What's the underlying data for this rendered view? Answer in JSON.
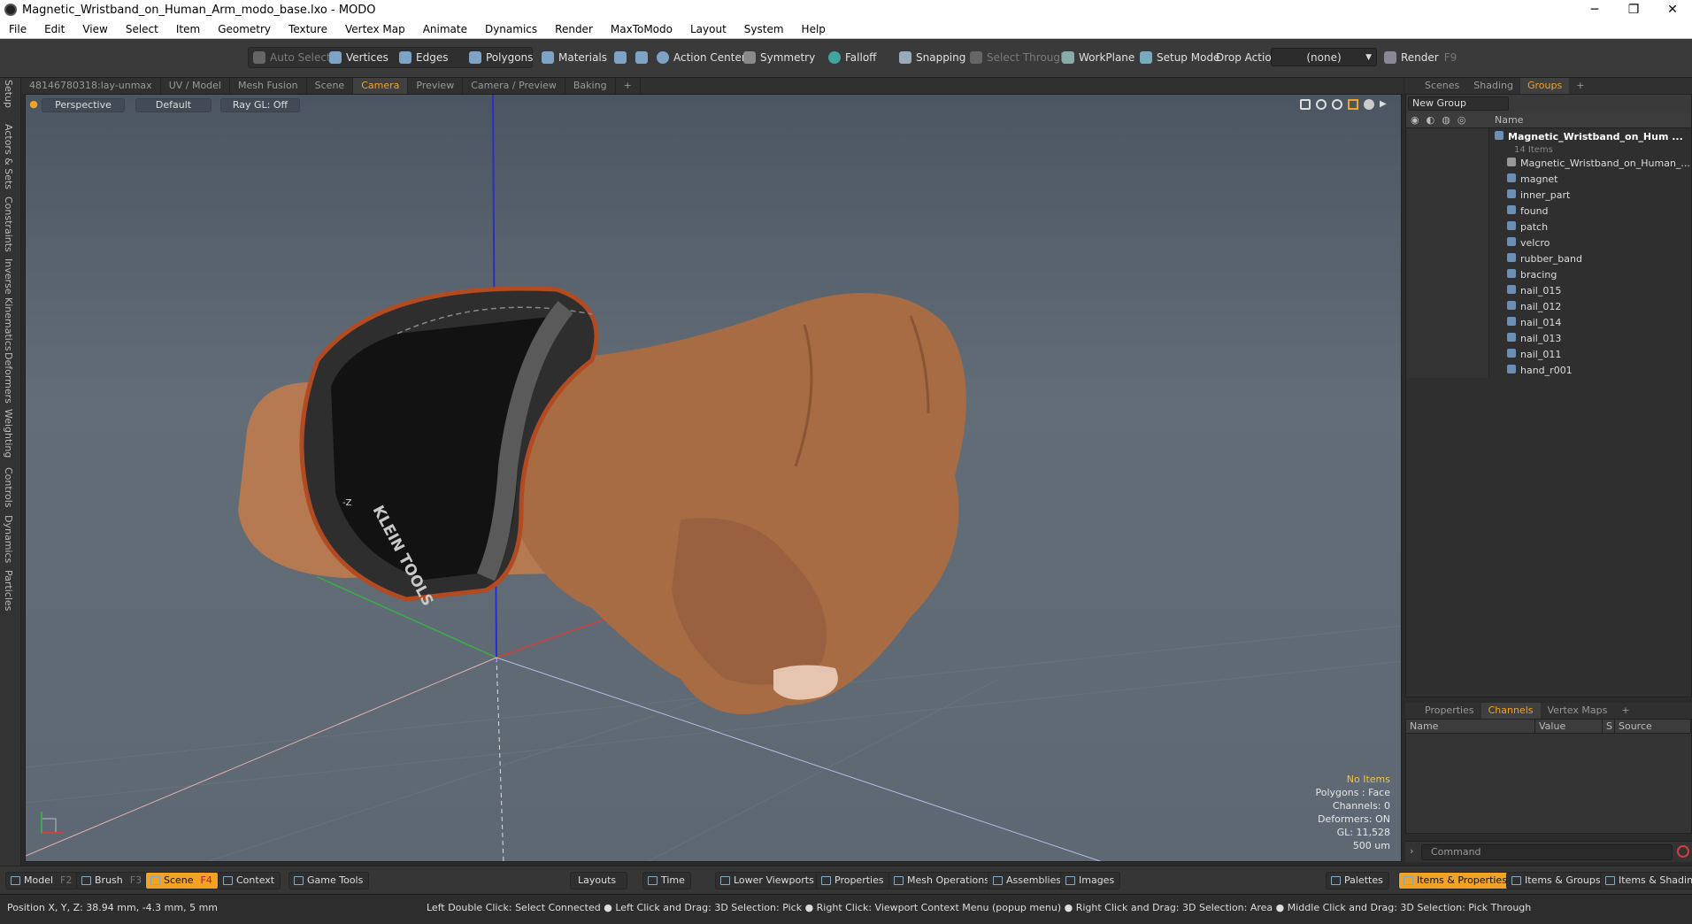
{
  "window": {
    "title": "Magnetic_Wristband_on_Human_Arm_modo_base.lxo - MODO",
    "minimize": "─",
    "restore": "❐",
    "close": "✕"
  },
  "menu": [
    "File",
    "Edit",
    "View",
    "Select",
    "Item",
    "Geometry",
    "Texture",
    "Vertex Map",
    "Animate",
    "Dynamics",
    "Render",
    "MaxToModo",
    "Layout",
    "System",
    "Help"
  ],
  "toolbar": {
    "auto_select": "Auto Select",
    "vertices": "Vertices",
    "edges": "Edges",
    "polygons": "Polygons",
    "materials": "Materials",
    "action_center": "Action Center",
    "symmetry": "Symmetry",
    "falloff": "Falloff",
    "snapping": "Snapping",
    "select_through": "Select Through",
    "workplane": "WorkPlane",
    "setup_mode": "Setup Mode",
    "drop_action": "Drop Action",
    "drop_value": "(none)",
    "render": "Render",
    "render_key": "F9"
  },
  "left_tabs": [
    "Setup",
    "Actors & Sets",
    "Constraints",
    "Inverse Kinematics",
    "Deformers",
    "Weighting",
    "Controls",
    "Dynamics",
    "Particles"
  ],
  "viewport_tabs": [
    "48146780318:lay-unmax",
    "UV / Model",
    "Mesh Fusion",
    "Scene",
    "Camera",
    "Preview",
    "Camera / Preview",
    "Baking",
    "+"
  ],
  "viewport_active_tab": "Camera",
  "viewport": {
    "view": "Perspective",
    "shading": "Default",
    "raygl": "Ray GL: Off",
    "axis_label": "-Z",
    "brand_text": "KLEIN TOOLS",
    "info": {
      "items": "No Items",
      "polygons": "Polygons : Face",
      "channels": "Channels: 0",
      "deformers": "Deformers: ON",
      "gl": "GL: 11,528",
      "units": "500 um"
    }
  },
  "right_tabs": [
    "Scenes",
    "Shading",
    "Groups",
    "+"
  ],
  "right_active_tab": "Groups",
  "groups": {
    "new_group": "New Group",
    "name_header": "Name",
    "root": "Magnetic_Wristband_on_Hum ...",
    "count": "14 Items",
    "items": [
      "Magnetic_Wristband_on_Human_...",
      "magnet",
      "inner_part",
      "found",
      "patch",
      "velcro",
      "rubber_band",
      "bracing",
      "nail_015",
      "nail_012",
      "nail_014",
      "nail_013",
      "nail_011",
      "hand_r001"
    ]
  },
  "channel_tabs": [
    "Properties",
    "Channels",
    "Vertex Maps",
    "+"
  ],
  "channel_active_tab": "Channels",
  "channel_headers": [
    "Name",
    "Value",
    "S",
    "Source"
  ],
  "command_placeholder": "Command",
  "bottom": {
    "model": "Model",
    "model_key": "F2",
    "brush": "Brush",
    "brush_key": "F3",
    "scene": "Scene",
    "scene_key": "F4",
    "context": "Context",
    "game_tools": "Game Tools",
    "layouts": "Layouts",
    "time": "Time",
    "lower_viewports": "Lower Viewports",
    "properties": "Properties",
    "mesh_operations": "Mesh Operations",
    "assemblies": "Assemblies",
    "images": "Images",
    "palettes": "Palettes",
    "items_properties": "Items & Properties",
    "items_groups": "Items & Groups",
    "items_shading": "Items & Shading"
  },
  "status": {
    "position": "Position X, Y, Z:   38.94 mm, -4.3 mm, 5 mm",
    "hint": "Left Double Click: Select Connected ● Left Click and Drag: 3D Selection: Pick ● Right Click: Viewport Context Menu (popup menu) ● Right Click and Drag: 3D Selection: Area ● Middle Click and Drag: 3D Selection: Pick Through"
  },
  "colors": {
    "accent": "#f2a324",
    "viewport_bg": "#5d6873",
    "skin": "#b07048",
    "band": "#2e2e2e",
    "band_trim": "#b24a22"
  }
}
